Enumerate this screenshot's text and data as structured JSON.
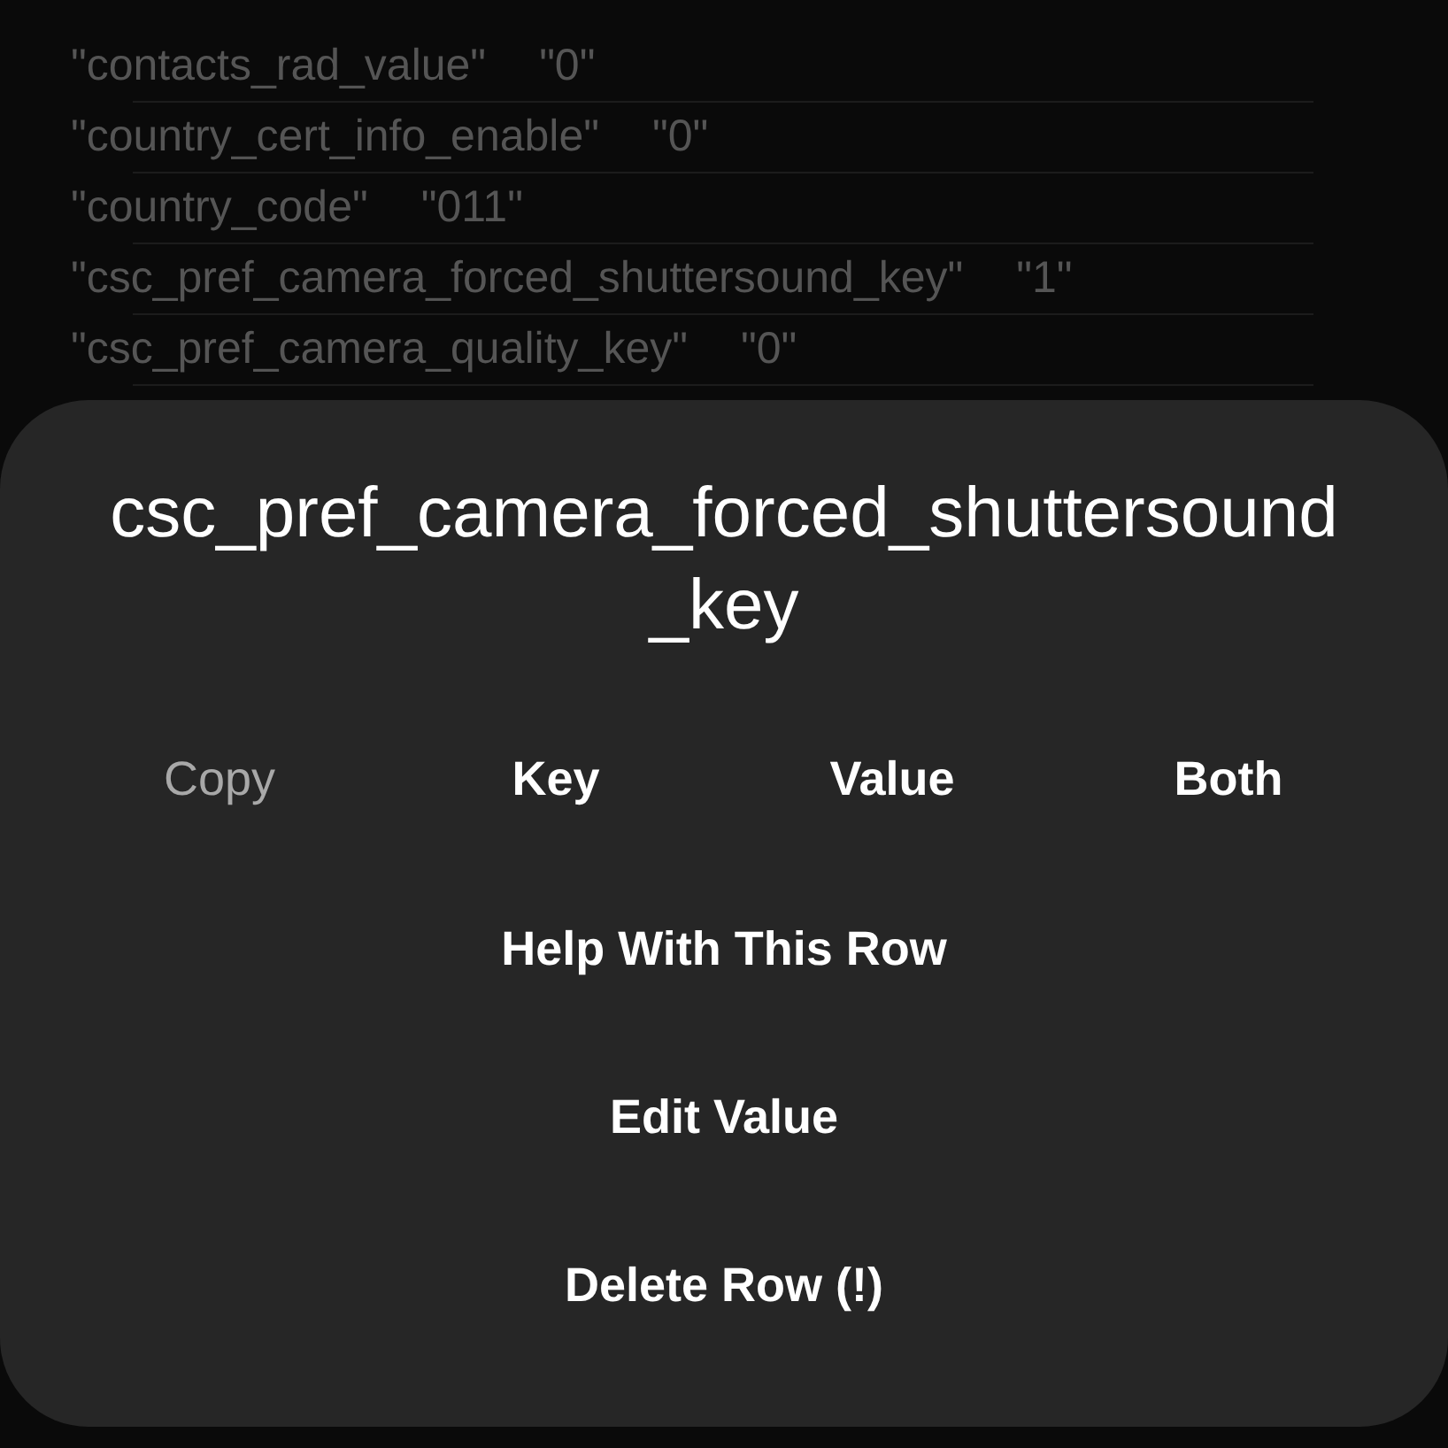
{
  "rows": [
    {
      "key": "\"contacts_rad_value\"",
      "value": "\"0\""
    },
    {
      "key": "\"country_cert_info_enable\"",
      "value": "\"0\""
    },
    {
      "key": "\"country_code\"",
      "value": "\"011\""
    },
    {
      "key": "\"csc_pref_camera_forced_shuttersound_key\"",
      "value": "\"1\""
    },
    {
      "key": "\"csc_pref_camera_quality_key\"",
      "value": "\"0\""
    }
  ],
  "sheet": {
    "title": "csc_pref_camera_forced_shuttersound_key",
    "copy_row": [
      {
        "kind": "label",
        "text": "Copy"
      },
      {
        "kind": "button",
        "text": "Key"
      },
      {
        "kind": "button",
        "text": "Value"
      },
      {
        "kind": "button",
        "text": "Both"
      }
    ],
    "actions": [
      "Help With This Row",
      "Edit Value",
      "Delete Row (!)"
    ]
  }
}
